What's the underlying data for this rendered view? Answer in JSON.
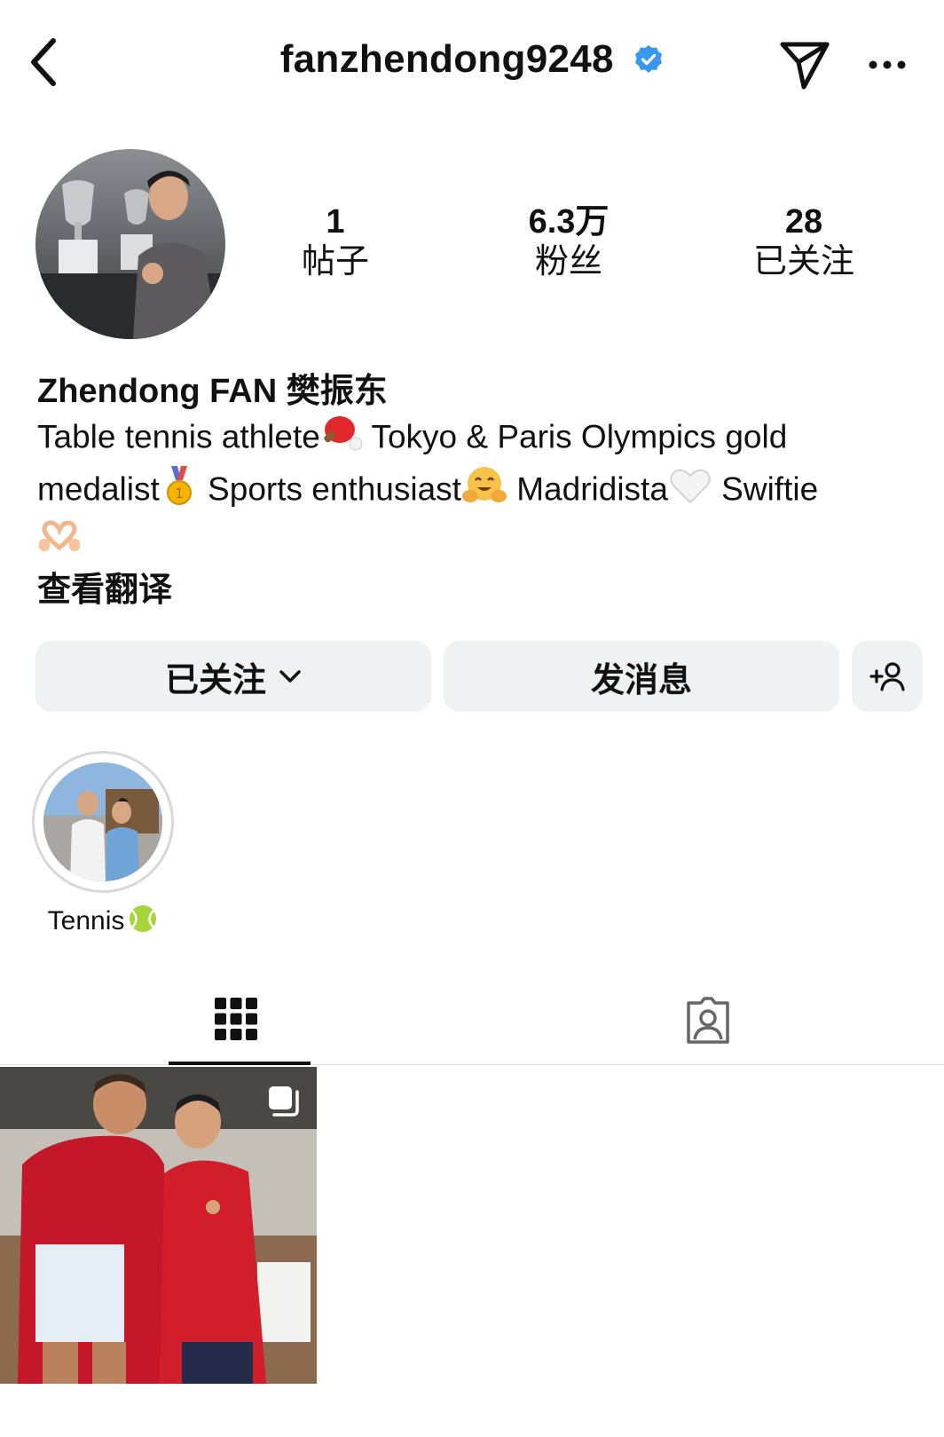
{
  "header": {
    "username": "fanzhendong9248",
    "verified_color": "#3897f0"
  },
  "stats": [
    {
      "value": "1",
      "label": "帖子"
    },
    {
      "value": "6.3万",
      "label": "粉丝"
    },
    {
      "value": "28",
      "label": "已关注"
    }
  ],
  "bio": {
    "display_name": "Zhendong FAN 樊振东",
    "line1": "Table tennis athlete",
    "line1b": " Tokyo & Paris Olympics gold",
    "line2a": "medalist",
    "line2b": " Sports enthusiast",
    "line2c": " Madridista",
    "line2d": " Swiftie",
    "translate_label": "查看翻译"
  },
  "actions": {
    "follow_label": "已关注",
    "message_label": "发消息"
  },
  "highlights": [
    {
      "label": "Tennis"
    }
  ],
  "icons": {
    "back": "chevron-left-icon",
    "verified": "verified-badge-icon",
    "send": "paper-plane-icon",
    "more": "more-dots-icon",
    "chevron": "chevron-down-icon",
    "add_person": "add-person-icon",
    "grid": "grid-icon",
    "tagged": "tagged-person-icon",
    "multi": "multiple-posts-icon"
  }
}
